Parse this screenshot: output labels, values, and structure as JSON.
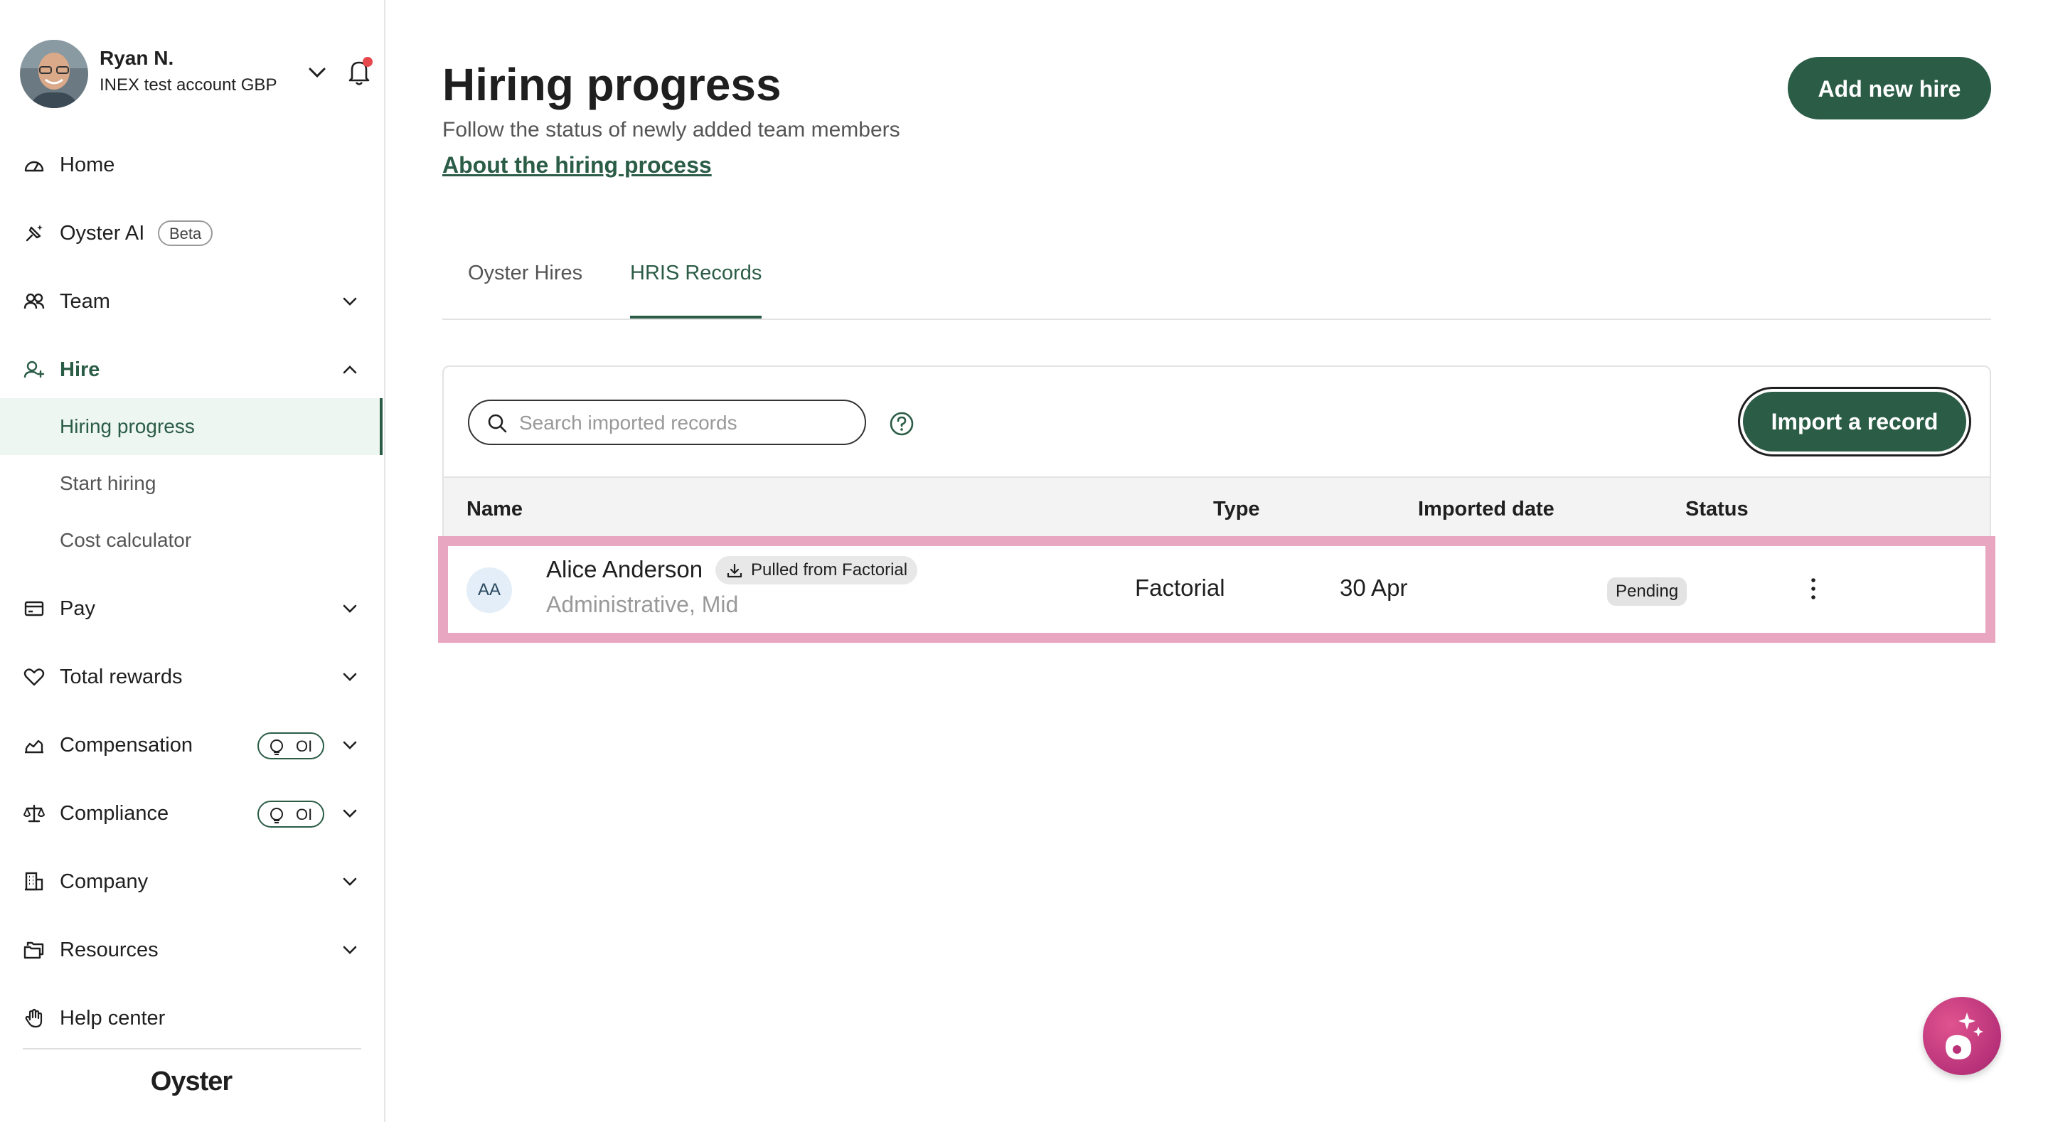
{
  "user": {
    "name": "Ryan N.",
    "account": "INEX test account GBP"
  },
  "nav": {
    "home": "Home",
    "oyster_ai": "Oyster AI",
    "beta": "Beta",
    "team": "Team",
    "hire": "Hire",
    "hire_sub": [
      "Hiring progress",
      "Start hiring",
      "Cost calculator"
    ],
    "pay": "Pay",
    "total_rewards": "Total rewards",
    "compensation": "Compensation",
    "compliance": "Compliance",
    "oi_badge": "OI",
    "company": "Company",
    "resources": "Resources",
    "help_center": "Help center"
  },
  "brand": "Oyster",
  "header": {
    "title": "Hiring progress",
    "subtitle": "Follow the status of newly added team members",
    "link": "About the hiring process",
    "add_button": "Add new hire"
  },
  "tabs": [
    {
      "label": "Oyster Hires",
      "active": false
    },
    {
      "label": "HRIS Records",
      "active": true
    }
  ],
  "records": {
    "search_placeholder": "Search imported records",
    "import_button": "Import a record",
    "columns": [
      "Name",
      "Type",
      "Imported date",
      "Status"
    ],
    "rows": [
      {
        "initials": "AA",
        "name": "Alice Anderson",
        "badge": "Pulled from Factorial",
        "role": "Administrative, Mid",
        "type": "Factorial",
        "date": "30 Apr",
        "status": "Pending"
      }
    ]
  },
  "colors": {
    "accent": "#2a5c46",
    "highlight": "#e8a6c0",
    "notification": "#e5484d",
    "ai_fab": "#c93a83"
  }
}
